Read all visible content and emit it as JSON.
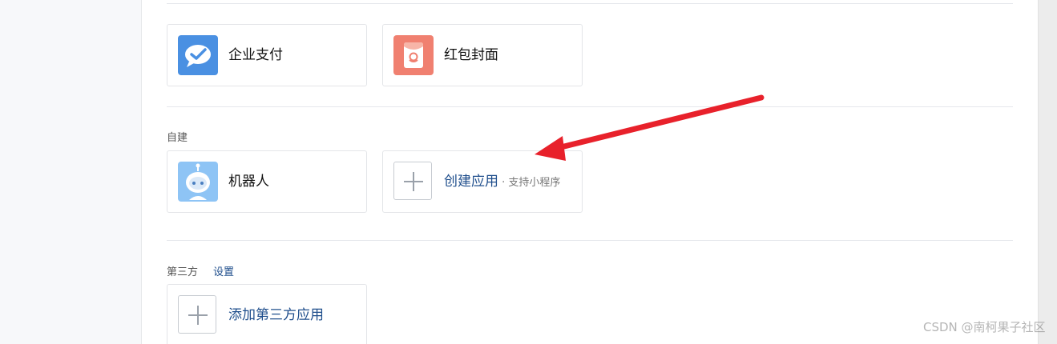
{
  "apps": {
    "enterprise_pay": "企业支付",
    "red_packet": "红包封面"
  },
  "custom": {
    "section_label": "自建",
    "robot": "机器人",
    "create_app": "创建应用",
    "create_app_sub": " · 支持小程序"
  },
  "third_party": {
    "section_label": "第三方",
    "settings_link": "设置",
    "add_app": "添加第三方应用"
  },
  "annotation": {
    "arrow_color": "#e8212b"
  },
  "watermark": "CSDN @南柯果子社区",
  "colors": {
    "link": "#1f4e8c",
    "pay_icon_bg": "#4a90e2",
    "red_packet_icon_bg": "#f08070"
  }
}
